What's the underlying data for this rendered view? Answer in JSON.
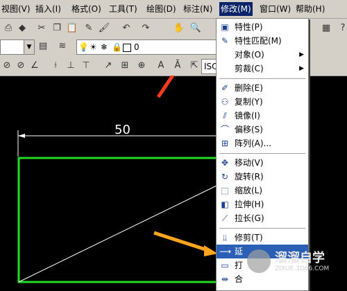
{
  "menubar": {
    "items": [
      "视图(V)",
      "插入(I)",
      "格式(O)",
      "工具(T)",
      "绘图(D)",
      "标注(N)",
      "修改(M)",
      "窗口(W)",
      "帮助(H)"
    ]
  },
  "toolbar": {
    "layer_value": "0",
    "style_value": "ISO"
  },
  "drawing": {
    "dimension_value": "50"
  },
  "modify_menu": {
    "items": [
      {
        "label": "特性(P)",
        "icon": "properties-icon"
      },
      {
        "label": "特性匹配(M)",
        "icon": "match-properties-icon"
      },
      {
        "label": "对象(O)",
        "icon": "",
        "submenu": true
      },
      {
        "label": "剪裁(C)",
        "icon": "",
        "submenu": true
      },
      {
        "label": "删除(E)",
        "icon": "erase-icon"
      },
      {
        "label": "复制(Y)",
        "icon": "copy-icon"
      },
      {
        "label": "镜像(I)",
        "icon": "mirror-icon"
      },
      {
        "label": "偏移(S)",
        "icon": "offset-icon"
      },
      {
        "label": "阵列(A)...",
        "icon": "array-icon"
      },
      {
        "label": "移动(V)",
        "icon": "move-icon"
      },
      {
        "label": "旋转(R)",
        "icon": "rotate-icon"
      },
      {
        "label": "缩放(L)",
        "icon": "scale-icon"
      },
      {
        "label": "拉伸(H)",
        "icon": "stretch-icon"
      },
      {
        "label": "拉长(G)",
        "icon": "lengthen-icon"
      },
      {
        "label": "修剪(T)",
        "icon": "trim-icon"
      },
      {
        "label": "延",
        "icon": "extend-icon"
      },
      {
        "label": "打",
        "icon": "break-icon"
      },
      {
        "label": "合",
        "icon": "join-icon"
      }
    ]
  },
  "watermark": {
    "title": "溜溜自学",
    "url": "ZIXUE.3D66.COM"
  },
  "colors": {
    "menu_bg": "#d4d0c8",
    "highlight": "#2b5fb5",
    "rectangle": "#22dd22",
    "arrow": "#ff3b1f",
    "arrow2": "#ffa51f"
  }
}
